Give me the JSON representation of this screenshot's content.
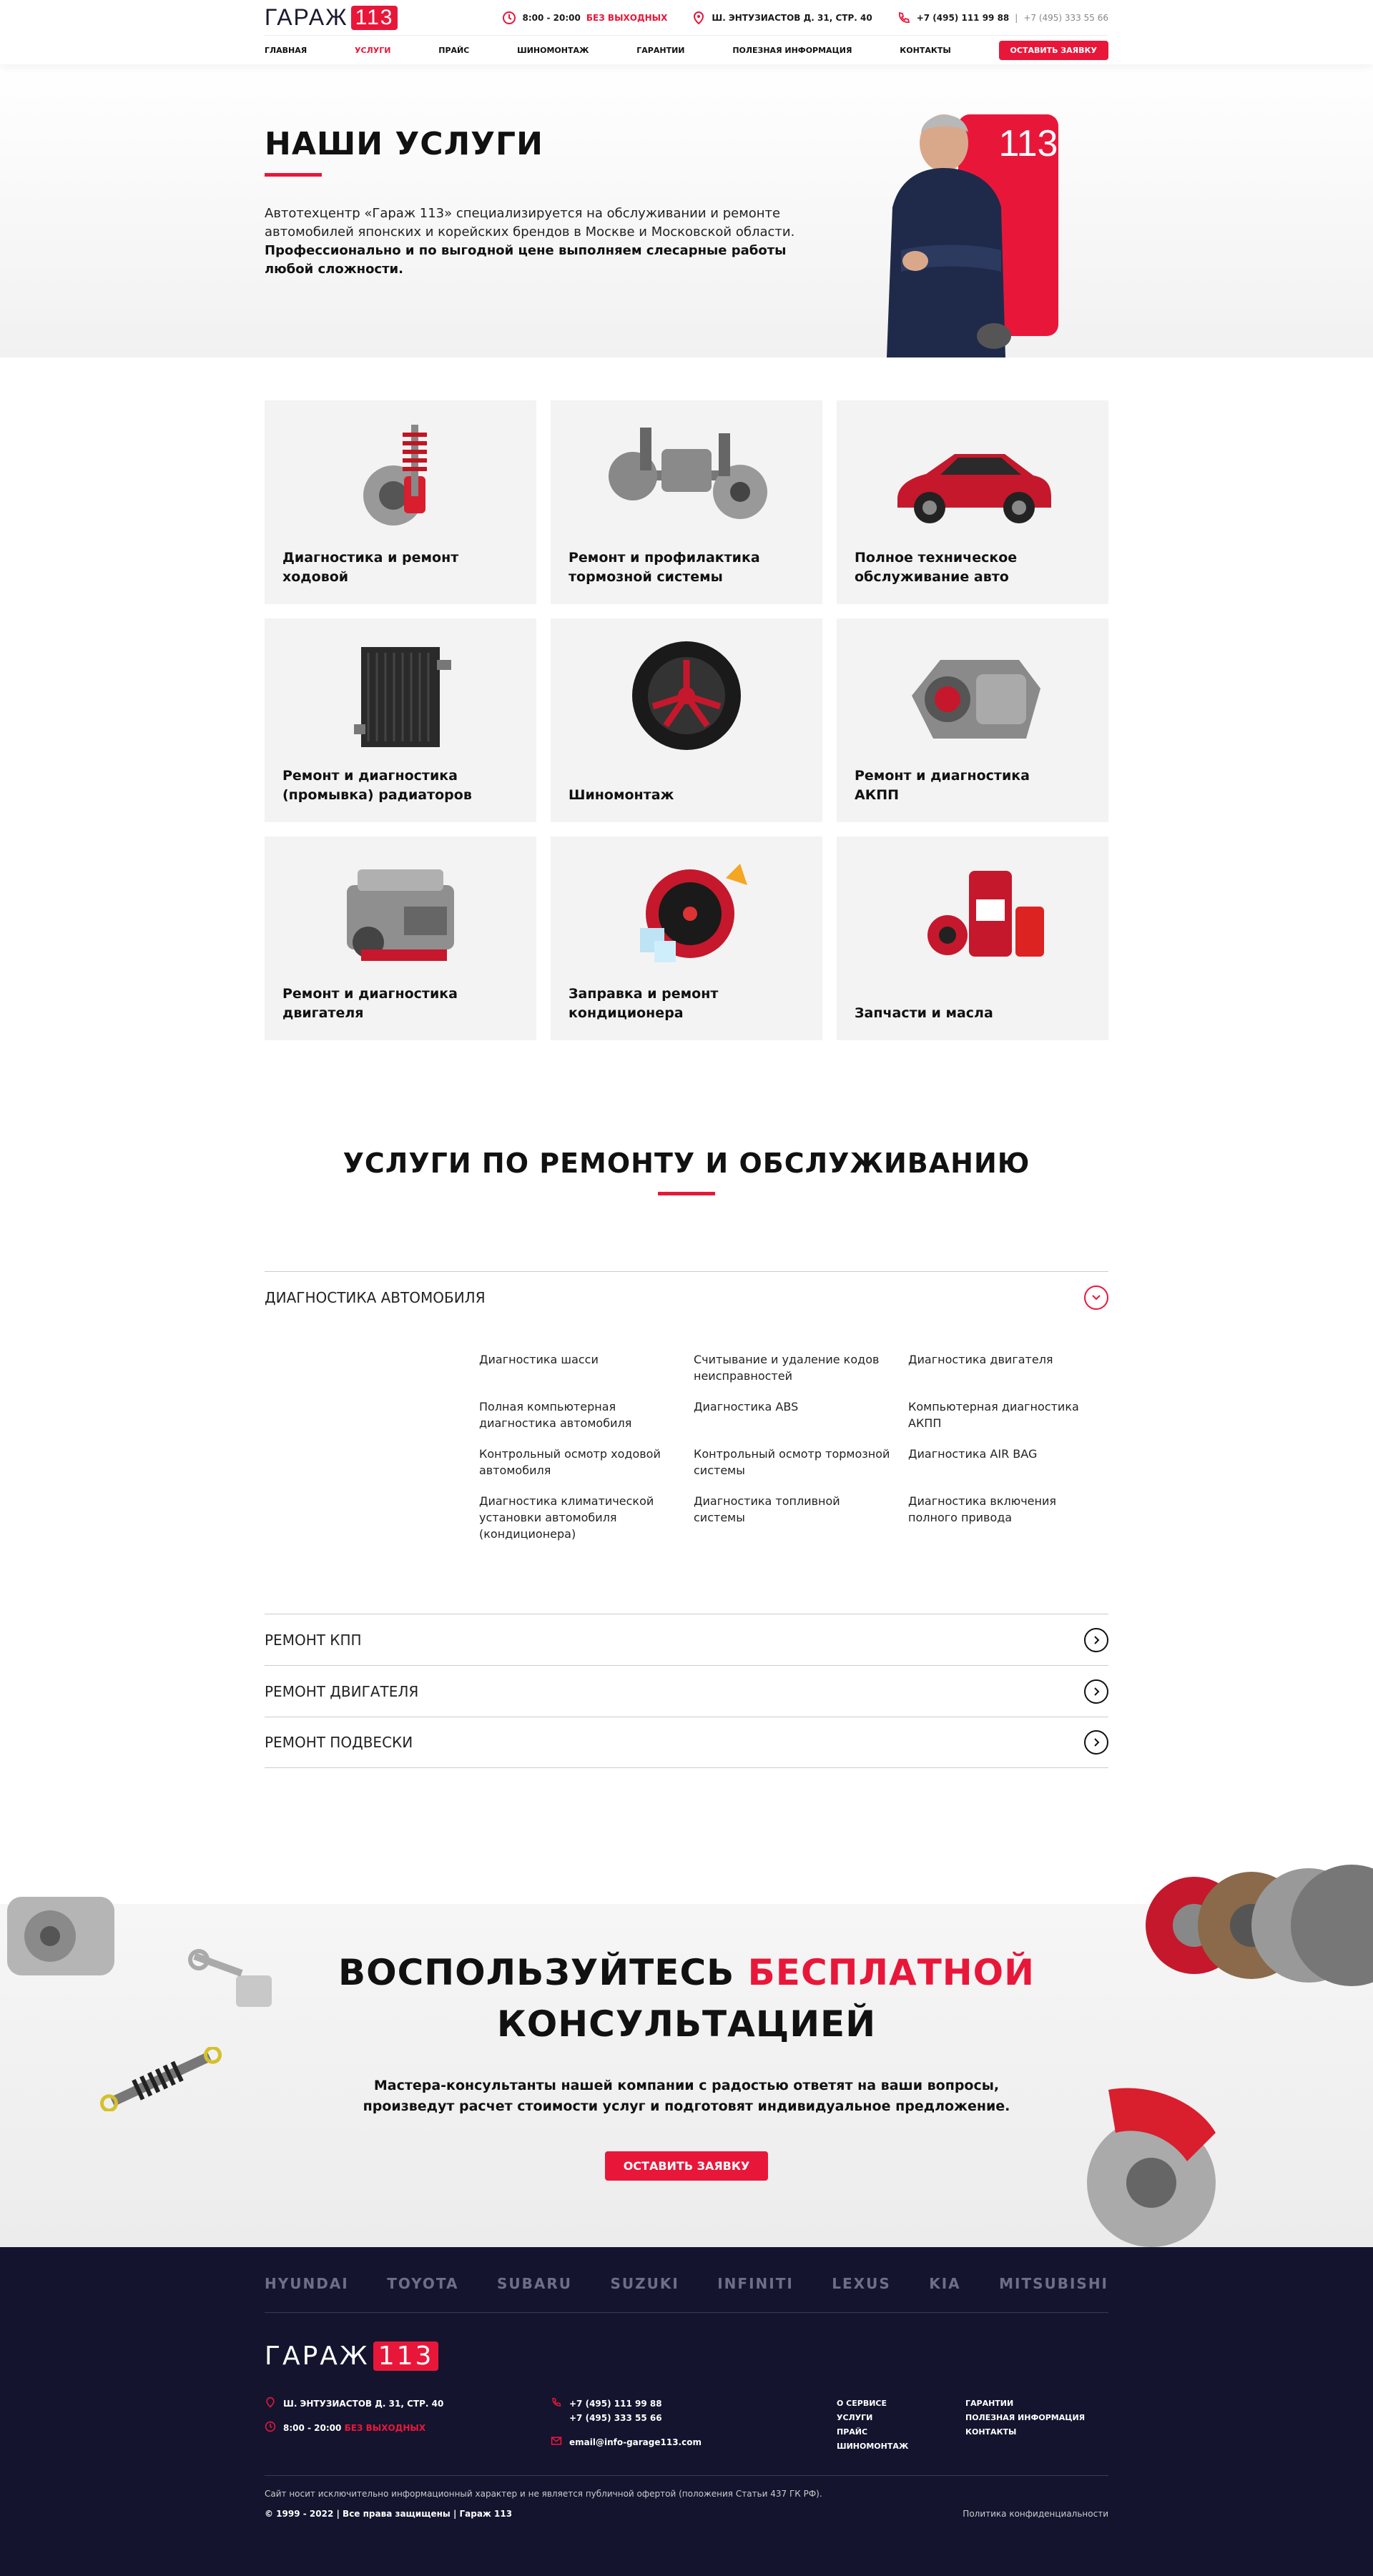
{
  "brand": {
    "name": "ГАРАЖ",
    "num": "113"
  },
  "header": {
    "hours": "8:00 - 20:00",
    "hours_tag": "БЕЗ ВЫХОДНЫХ",
    "address": "Ш. ЭНТУЗИАСТОВ Д. 31, СТР. 40",
    "phone1": "+7 (495) 111 99 88",
    "phone_sep": " | ",
    "phone2": "+7 (495) 333 55 66"
  },
  "nav": {
    "items": [
      "ГЛАВНАЯ",
      "УСЛУГИ",
      "ПРАЙС",
      "ШИНОМОНТАЖ",
      "ГАРАНТИИ",
      "ПОЛЕЗНАЯ ИНФОРМАЦИЯ",
      "КОНТАКТЫ"
    ],
    "active": 1,
    "cta": "ОСТАВИТЬ ЗАЯВКУ"
  },
  "hero": {
    "title": "НАШИ УСЛУГИ",
    "text": "Автотехцентр «Гараж 113» специализируется на обслуживании и ремонте автомобилей японских и корейских брендов в Москве и Московской области.",
    "text_bold": "Профессионально и по выгодной цене выполняем слесарные работы любой сложности.",
    "badge": "113"
  },
  "cards": [
    {
      "label": "Диагностика и ремонт ходовой",
      "icon": "shock-absorber-icon"
    },
    {
      "label": "Ремонт и профилактика тормозной системы",
      "icon": "axle-icon"
    },
    {
      "label": "Полное техническое обслуживание авто",
      "icon": "car-icon"
    },
    {
      "label": "Ремонт и диагностика (промывка) радиаторов",
      "icon": "radiator-icon"
    },
    {
      "label": "Шиномонтаж",
      "icon": "wheel-icon"
    },
    {
      "label": "Ремонт и диагностика АКПП",
      "icon": "gearbox-icon"
    },
    {
      "label": "Ремонт и диагностика двигателя",
      "icon": "engine-icon"
    },
    {
      "label": "Заправка и ремонт кондиционера",
      "icon": "ac-icon"
    },
    {
      "label": "Запчасти и масла",
      "icon": "oil-icon"
    }
  ],
  "services": {
    "title": "УСЛУГИ ПО РЕМОНТУ И ОБСЛУЖИВАНИЮ",
    "open": {
      "label": "ДИАГНОСТИКА АВТОМОБИЛЯ",
      "items": [
        "Диагностика шасси",
        "Считывание и удаление кодов неисправностей",
        "Диагностика двигателя",
        "Полная компьютерная диагностика автомобиля",
        "Диагностика ABS",
        "Компьютерная диагностика АКПП",
        "Контрольный осмотр ходовой автомобиля",
        "Контрольный осмотр тормозной системы",
        "Диагностика AIR BAG",
        "Диагностика климатической установки автомобиля (кондиционера)",
        "Диагностика топливной системы",
        "Диагностика включения полного привода"
      ]
    },
    "closed": [
      "РЕМОНТ КПП",
      "РЕМОНТ ДВИГАТЕЛЯ",
      "РЕМОНТ ПОДВЕСКИ"
    ]
  },
  "cta": {
    "title_a": "ВОСПОЛЬЗУЙТЕСЬ ",
    "title_red": "БЕСПЛАТНОЙ",
    "title_b": "КОНСУЛЬТАЦИЕЙ",
    "text": "Мастера-консультанты нашей компании с радостью ответят на ваши вопросы, произведут расчет стоимости услуг и подготовят индивидуальное предложение.",
    "button": "ОСТАВИТЬ ЗАЯВКУ"
  },
  "footer": {
    "brands": [
      "HYUNDAI",
      "TOYOTA",
      "SUBARU",
      "SUZUKI",
      "INFINITI",
      "LEXUS",
      "KIA",
      "MITSUBISHI"
    ],
    "address": "Ш. ЭНТУЗИАСТОВ Д. 31, СТР. 40",
    "hours": "8:00 - 20:00",
    "hours_tag": "БЕЗ ВЫХОДНЫХ",
    "phone1": "+7 (495) 111 99 88",
    "phone2": "+7 (495) 333 55 66",
    "email": "email@info-garage113.com",
    "links1": [
      "О СЕРВИСЕ",
      "УСЛУГИ",
      "ПРАЙС",
      "ШИНОМОНТАЖ"
    ],
    "links2": [
      "ГАРАНТИИ",
      "ПОЛЕЗНАЯ ИНФОРМАЦИЯ",
      "КОНТАКТЫ"
    ],
    "disclaimer": "Сайт носит исключительно информационный характер и не является публичной офертой (положения Статьи 437 ГК РФ).",
    "copyright": "© 1999 - 2022 | Все права защищены | Гараж 113",
    "privacy": "Политика конфиденциальности"
  },
  "colors": {
    "accent": "#e8173a",
    "dark": "#14142e"
  }
}
